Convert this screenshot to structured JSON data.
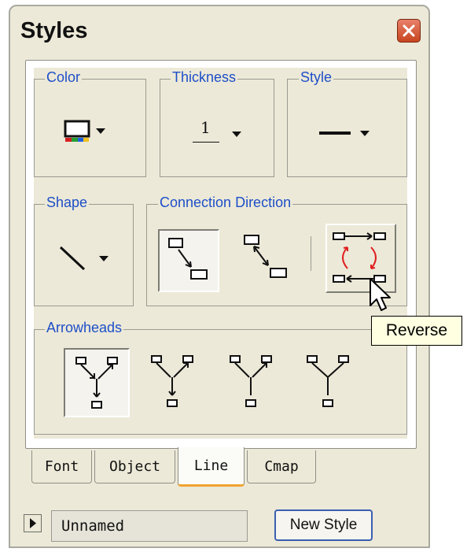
{
  "window": {
    "title": "Styles"
  },
  "groups": {
    "color": "Color",
    "thickness": "Thickness",
    "style": "Style",
    "shape": "Shape",
    "connection_direction": "Connection Direction",
    "arrowheads": "Arrowheads"
  },
  "thickness_value": "1",
  "tooltip": "Reverse",
  "tabs": [
    {
      "label": "Font",
      "active": false
    },
    {
      "label": "Object",
      "active": false
    },
    {
      "label": "Line",
      "active": true
    },
    {
      "label": "Cmap",
      "active": false
    }
  ],
  "bottom_bar": {
    "style_name": "Unnamed",
    "new_style_button": "New Style"
  },
  "colors": {
    "accent_text": "#1e4fc8",
    "active_tab_underline": "#f0a32f",
    "reverse_arrows": "#e02020"
  },
  "icons": {
    "close": "close-icon",
    "color_picker": "color-picker-icon",
    "dropdown": "triangle-down-icon",
    "line_style": "solid-line-icon",
    "shape": "diagonal-line-icon",
    "direction_forward": "direction-forward-icon",
    "direction_backward": "direction-backward-icon",
    "reverse": "reverse-icon",
    "pointer": "mouse-pointer-icon",
    "play": "triangle-right-icon"
  }
}
